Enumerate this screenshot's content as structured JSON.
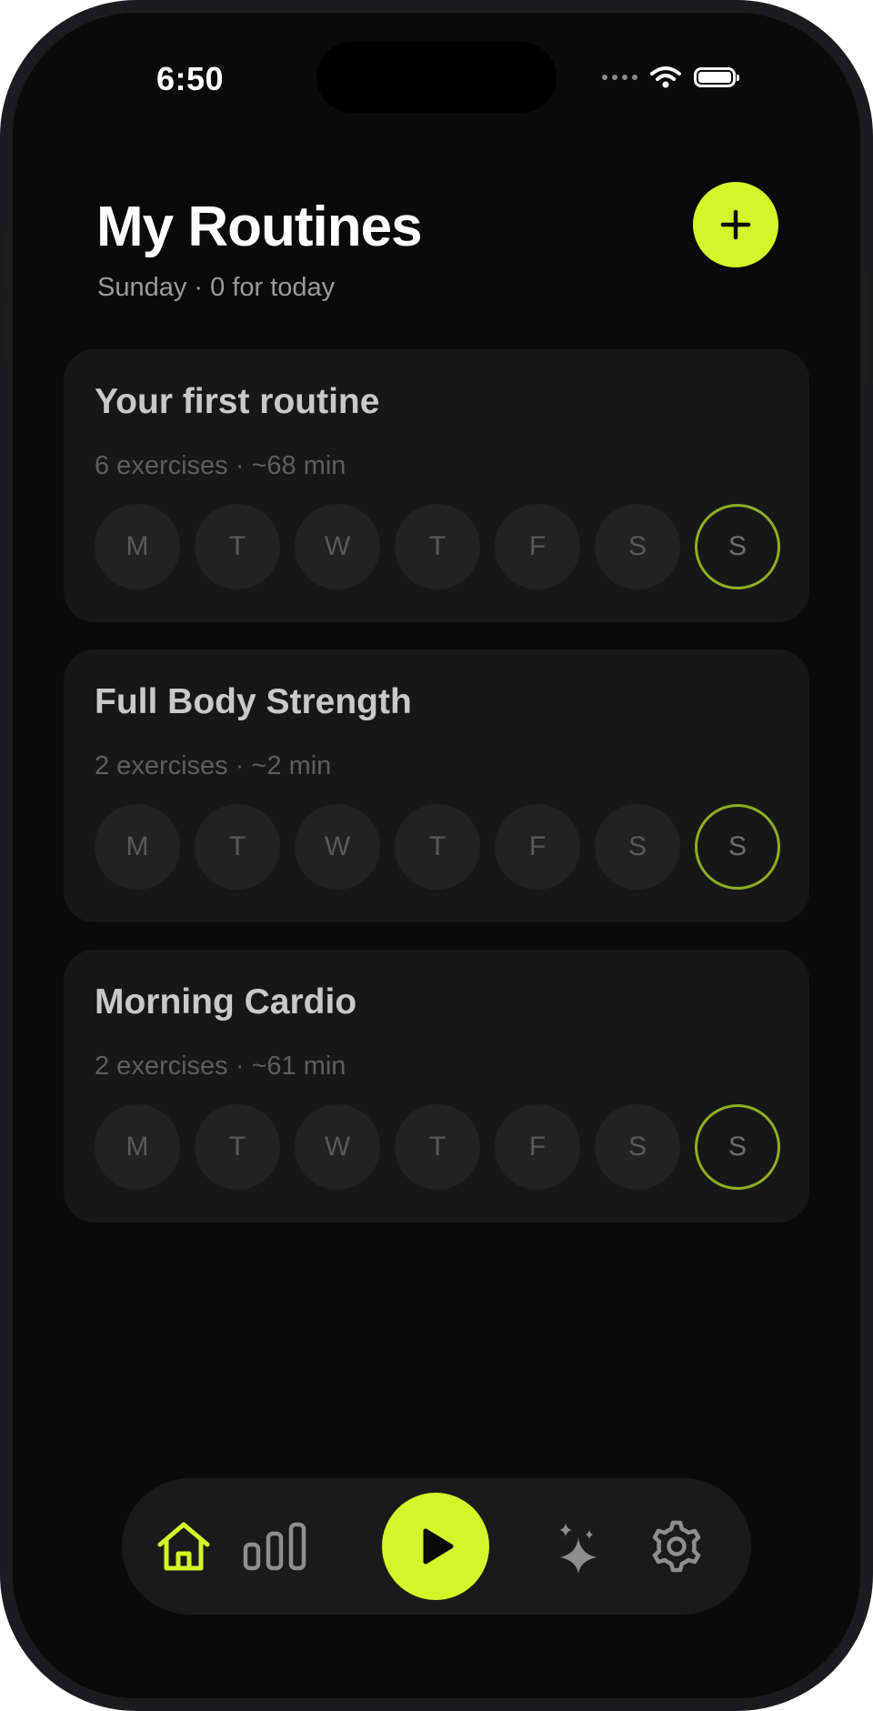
{
  "status_bar": {
    "time": "6:50"
  },
  "header": {
    "title": "My Routines",
    "subtitle": "Sunday · 0 for today",
    "add_icon": "plus-icon"
  },
  "colors": {
    "accent": "#d3f52a",
    "today_ring": "#8fae23",
    "card_bg": "#171717",
    "screen_bg": "#0a0a0a"
  },
  "routines": [
    {
      "name": "Your first routine",
      "meta": "6 exercises · ~68 min"
    },
    {
      "name": "Full Body Strength",
      "meta": "2 exercises · ~2 min"
    },
    {
      "name": "Morning Cardio",
      "meta": "2 exercises · ~61 min"
    }
  ],
  "days": [
    "M",
    "T",
    "W",
    "T",
    "F",
    "S",
    "S"
  ],
  "today_index": 6,
  "tab_bar": [
    {
      "icon": "home-icon",
      "active": true
    },
    {
      "icon": "stats-icon",
      "active": false
    },
    {
      "icon": "play-icon",
      "active": false
    },
    {
      "icon": "sparkle-icon",
      "active": false
    },
    {
      "icon": "gear-icon",
      "active": false
    }
  ]
}
